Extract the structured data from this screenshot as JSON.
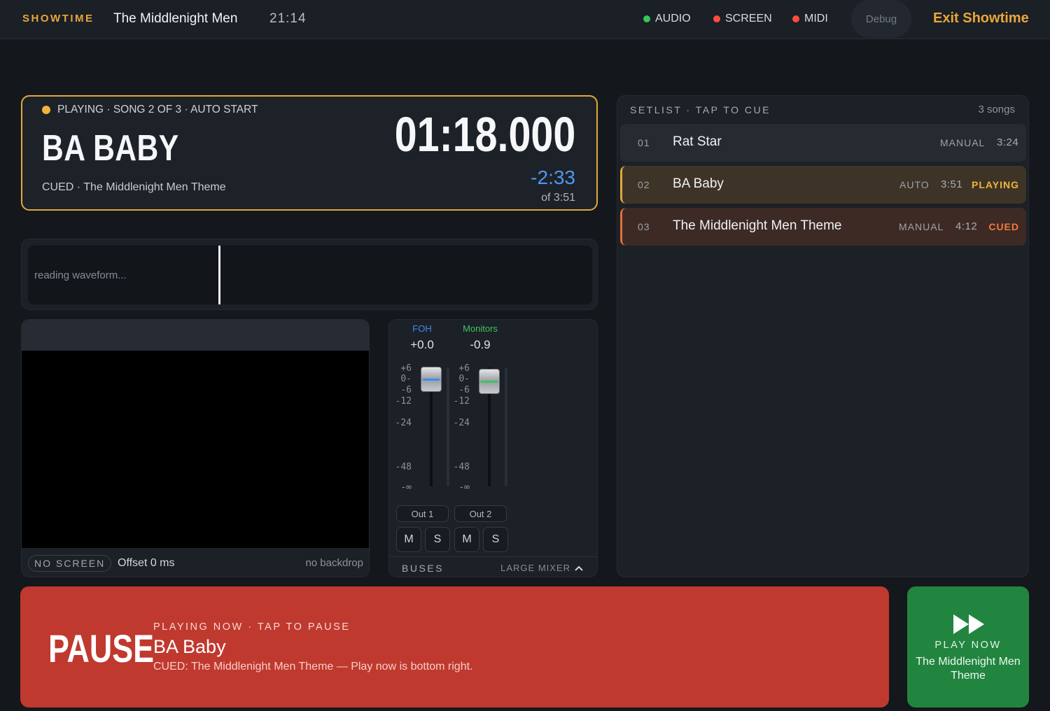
{
  "topbar": {
    "brand": "SHOWTIME",
    "show_title": "The Middlenight Men",
    "clock": "21:14",
    "statuses": [
      {
        "label": "AUDIO",
        "color": "#34c759"
      },
      {
        "label": "SCREEN",
        "color": "#ff4d3d"
      },
      {
        "label": "MIDI",
        "color": "#ff4d3d"
      }
    ],
    "debug_label": "Debug",
    "exit_label": "Exit Showtime"
  },
  "now_playing": {
    "status": "PLAYING · SONG 2 OF 3 · AUTO START",
    "status_color": "#f0b43c",
    "title": "BA BABY",
    "cued": "CUED · The Middlenight Men Theme",
    "elapsed": "01:18.000",
    "remaining": "-2:33",
    "total": "of 3:51"
  },
  "waveform": {
    "text": "reading waveform...",
    "playhead_fraction": 0.338
  },
  "screen": {
    "status_pill": "NO SCREEN",
    "offset": "Offset 0 ms",
    "backdrop": "no backdrop"
  },
  "mixer": {
    "buses": [
      {
        "name": "FOH",
        "color": "#3d8ef0",
        "db": "+0.0",
        "output": "Out 1"
      },
      {
        "name": "Monitors",
        "color": "#3fc45a",
        "db": "-0.9",
        "output": "Out 2"
      }
    ],
    "scale_labels": [
      "+6",
      "0-",
      "-6",
      "-12",
      "-24",
      "-48",
      "-∞"
    ],
    "mute_label": "M",
    "solo_label": "S",
    "footer_label": "BUSES",
    "large_mixer_label": "LARGE MIXER"
  },
  "setlist": {
    "title": "SETLIST · TAP TO CUE",
    "count": "3 songs",
    "songs": [
      {
        "num": "01",
        "name": "Rat Star",
        "mode": "MANUAL",
        "duration": "3:24",
        "badge": "",
        "state": "normal"
      },
      {
        "num": "02",
        "name": "BA Baby",
        "mode": "AUTO",
        "duration": "3:51",
        "badge": "PLAYING",
        "state": "playing"
      },
      {
        "num": "03",
        "name": "The Middlenight Men Theme",
        "mode": "MANUAL",
        "duration": "4:12",
        "badge": "CUED",
        "state": "cued"
      }
    ],
    "colors": {
      "playing": "#f0b43c",
      "cued": "#f07a3c"
    }
  },
  "transport": {
    "pause_label": "PAUSE",
    "pause_sub": "PLAYING NOW · TAP TO PAUSE",
    "pause_song": "BA Baby",
    "pause_cued": "CUED: The Middlenight Men Theme — Play now is bottom right.",
    "play_label": "PLAY NOW",
    "play_song": "The Middlenight Men Theme"
  }
}
